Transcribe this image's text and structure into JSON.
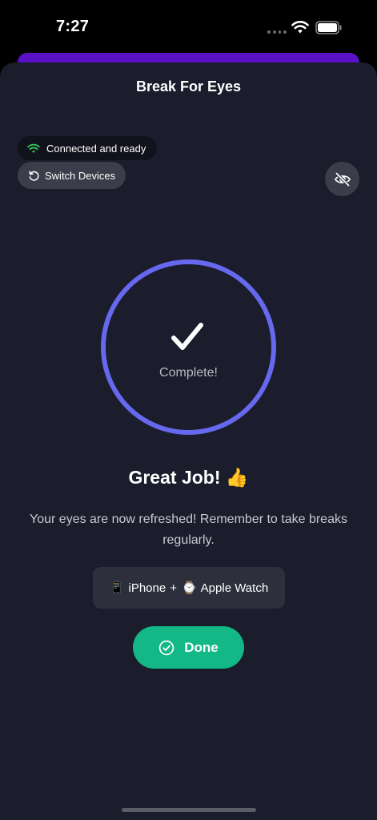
{
  "status_bar": {
    "time": "7:27",
    "icons": [
      "signal-dots-icon",
      "wifi-icon",
      "battery-icon"
    ]
  },
  "sheet": {
    "title": "Break For Eyes"
  },
  "connection": {
    "status_text": "Connected and ready",
    "icon": "wifi-icon",
    "accent_color": "#34c759"
  },
  "switch_devices": {
    "label": "Switch Devices",
    "icon": "refresh-icon"
  },
  "eye_toggle": {
    "icon": "eye-slash-icon"
  },
  "progress": {
    "status_label": "Complete!",
    "icon": "checkmark-icon",
    "ring_color": "#6669ee",
    "fraction_complete": 1.0
  },
  "result": {
    "heading": "Great Job! 👍",
    "message": "Your eyes are now refreshed! Remember to take breaks regularly."
  },
  "devices": {
    "phone_glyph": "📱",
    "phone_label": "iPhone",
    "separator": "+",
    "watch_glyph": "⌚",
    "watch_label": "Apple Watch"
  },
  "done_button": {
    "label": "Done",
    "icon": "check-circle-icon",
    "color": "#13b886"
  },
  "theme": {
    "background": "#1b1c2c",
    "header_accent": "#5a10c4"
  }
}
